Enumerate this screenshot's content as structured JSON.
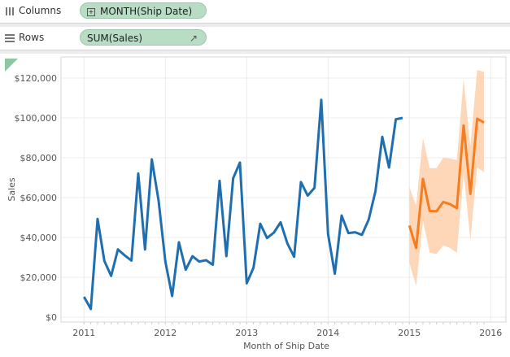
{
  "shelves": {
    "columns": {
      "label": "Columns",
      "pill": "MONTH(Ship Date)",
      "icon": "columns-icon"
    },
    "rows": {
      "label": "Rows",
      "pill": "SUM(Sales)",
      "icon": "rows-icon"
    }
  },
  "chart_data": {
    "type": "line",
    "xlabel": "Month of Ship Date",
    "ylabel": "Sales",
    "ylim": [
      0,
      126000
    ],
    "xlim": [
      "2010-10",
      "2016-03"
    ],
    "x_ticks": [
      "2011",
      "2012",
      "2013",
      "2014",
      "2015",
      "2016"
    ],
    "y_ticks": [
      "$0",
      "$20,000",
      "$40,000",
      "$60,000",
      "$80,000",
      "$100,000",
      "$120,000"
    ],
    "y_tick_values": [
      0,
      20000,
      40000,
      60000,
      80000,
      100000,
      120000
    ],
    "grid": true,
    "colors": {
      "actual": "#1f6fb0",
      "forecast": "#f57c1f",
      "band": "#fdd0ac"
    },
    "series": [
      {
        "kind": "actual",
        "start": "2011-01",
        "values": [
          10200,
          4100,
          49300,
          28200,
          20700,
          34000,
          31000,
          28400,
          72100,
          34000,
          79200,
          58500,
          27900,
          10600,
          37600,
          23800,
          30600,
          27900,
          28600,
          26300,
          68400,
          30600,
          69700,
          77600,
          17000,
          24800,
          46900,
          39700,
          42400,
          47600,
          37000,
          30300,
          67800,
          61000,
          64900,
          109100,
          41800,
          21800,
          51000,
          42200,
          42600,
          41300,
          49000,
          63300,
          90500,
          75100,
          99300,
          100000
        ]
      },
      {
        "kind": "forecast",
        "start": "2015-01",
        "values": [
          46000,
          34700,
          69400,
          53300,
          53100,
          57800,
          56700,
          54700,
          96200,
          61900,
          99600,
          97700
        ],
        "upper": [
          65300,
          56000,
          89800,
          74800,
          74800,
          80000,
          79600,
          78900,
          119500,
          85700,
          124100,
          123000
        ],
        "lower": [
          27200,
          15600,
          48300,
          32400,
          31700,
          36000,
          34700,
          32400,
          72100,
          38800,
          75100,
          72800
        ]
      }
    ]
  }
}
